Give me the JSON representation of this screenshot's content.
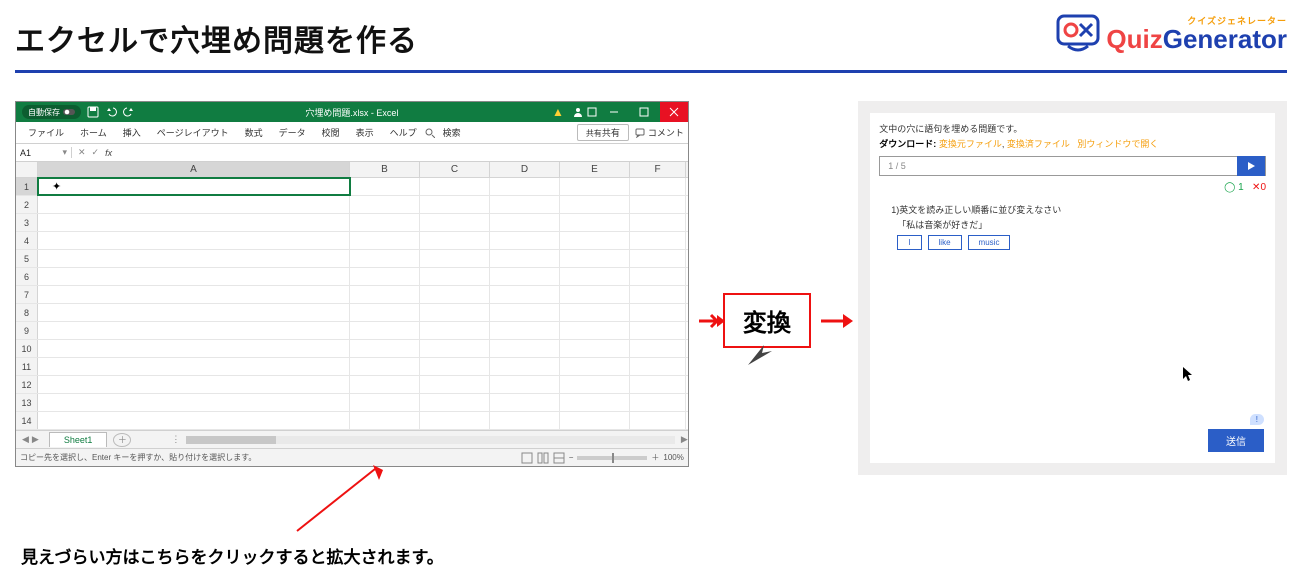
{
  "page": {
    "title": "エクセルで穴埋め問題を作る",
    "note": "見えづらい方はこちらをクリックすると拡大されます。"
  },
  "logo": {
    "kana": "クイズジェネレーター",
    "quiz": "Quiz",
    "gen": "Generator"
  },
  "excel": {
    "autosave": "自動保存",
    "filename": "穴埋め問題.xlsx - Excel",
    "tabs": [
      "ファイル",
      "ホーム",
      "挿入",
      "ページレイアウト",
      "数式",
      "データ",
      "校閲",
      "表示",
      "ヘルプ"
    ],
    "search": "検索",
    "share": "共有",
    "comment": "コメント",
    "cell_ref": "A1",
    "col_labels": [
      "A",
      "B",
      "C",
      "D",
      "E",
      "F"
    ],
    "row_count": 14,
    "sheet_name": "Sheet1",
    "status": "コピー先を選択し、Enter キーを押すか、貼り付けを選択します。",
    "zoom": "100%"
  },
  "convert": {
    "label": "変換"
  },
  "quiz": {
    "desc": "文中の穴に語句を埋める問題です。",
    "dl_label": "ダウンロード:",
    "link1": "変換元ファイル",
    "link2": "変換済ファイル",
    "link3": "別ウィンドウで開く",
    "progress": "1 / 5",
    "ok": "1",
    "ng": "0",
    "question": "1)英文を読み正しい順番に並び変えなさい",
    "subtext": "「私は音楽が好きだ」",
    "blanks": [
      "I",
      "like",
      "music"
    ],
    "hint": "!",
    "submit": "送信"
  }
}
